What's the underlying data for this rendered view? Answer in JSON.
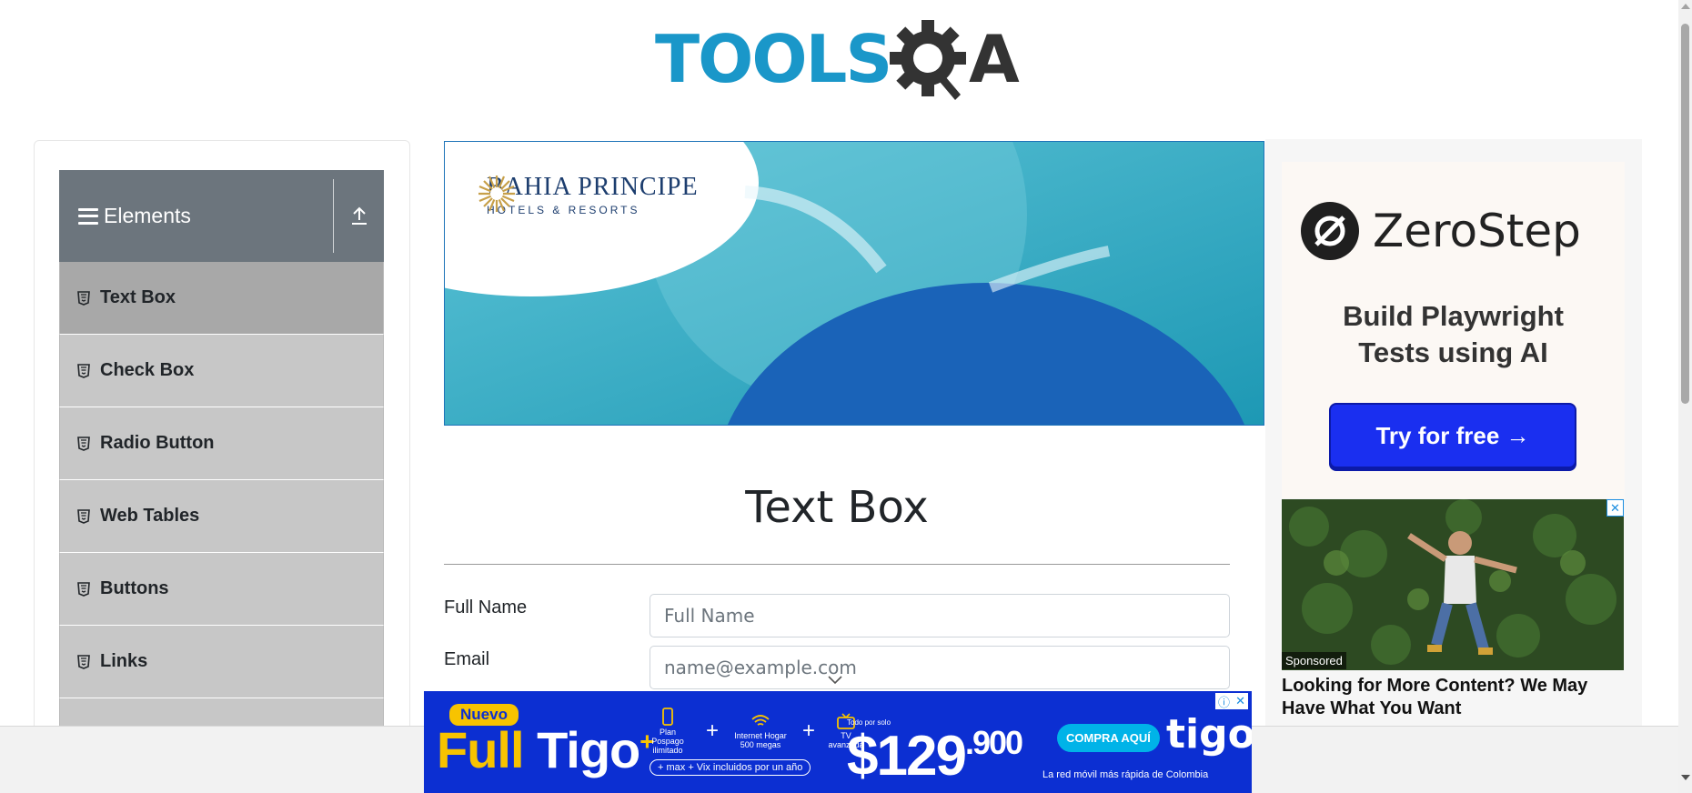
{
  "header": {
    "logo_text_left": "TOOLS",
    "logo_text_right": "A"
  },
  "sidebar": {
    "group_title": "Elements",
    "items": [
      {
        "label": "Text Box",
        "active": true
      },
      {
        "label": "Check Box",
        "active": false
      },
      {
        "label": "Radio Button",
        "active": false
      },
      {
        "label": "Web Tables",
        "active": false
      },
      {
        "label": "Buttons",
        "active": false
      },
      {
        "label": "Links",
        "active": false
      }
    ]
  },
  "banner_ad": {
    "brand_name": "BAHIA PRINCIPE",
    "brand_sub": "HOTELS & RESORTS"
  },
  "main": {
    "title": "Text Box",
    "fields": [
      {
        "label": "Full Name",
        "placeholder": "Full Name"
      },
      {
        "label": "Email",
        "placeholder": "name@example.com"
      }
    ]
  },
  "right_ad": {
    "logo_text": "ZeroStep",
    "headline": "Build Playwright Tests using AI",
    "cta": "Try for free →"
  },
  "sponsored": {
    "tag": "Sponsored",
    "text": "Looking for More Content? We May Have What You Want",
    "close": "✕"
  },
  "bottom_ad": {
    "nuevo": "Nuevo",
    "full": "Full",
    "brand_word": "Tigo",
    "plus_mark": "+",
    "item1": "Plan Pospago ilimitado",
    "item2": "Internet Hogar 500 megas",
    "item3": "TV avanzada",
    "bundle": "+ max + Vix incluidos por un año",
    "price_label": "Todo por solo",
    "price_main": "$129",
    "price_cents": ".900",
    "cta": "COMPRA AQUÍ",
    "logo": "tigo",
    "tagline": "La red móvil más rápida de Colombia"
  },
  "colors": {
    "sidebar_header": "#6c757d",
    "menu_item": "#c7c7c7",
    "menu_item_active": "#a8a8a8",
    "logo_blue": "#1a97c9",
    "logo_dark": "#333333",
    "cta_blue": "#1a2ff0",
    "bottom_ad_blue": "#0c2fd2"
  }
}
